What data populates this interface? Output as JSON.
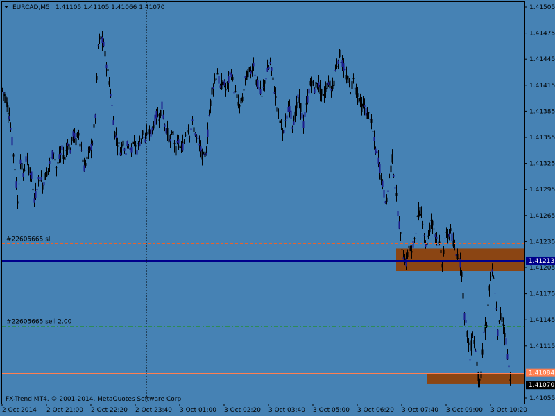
{
  "header": {
    "symbol_label": "EURCAD,M5",
    "ohlc": "1.41105 1.41105 1.41066 1.41070"
  },
  "footer": {
    "copyright": "FX-Trend MT4, © 2001-2014, MetaQuotes Software Corp."
  },
  "colors": {
    "background": "#4682b4",
    "frame": "#000000",
    "bar_body": "#1c1c8c",
    "bar_wick": "#000000",
    "zone": "#8b4513",
    "sl_line": "#e8632c",
    "order_line": "#2e8b57",
    "bid_line": "#00008b",
    "current_line": "#c0c0c0",
    "orange_line": "#ff7f50"
  },
  "chart_data": {
    "type": "candlestick",
    "symbol": "EURCAD",
    "timeframe": "M5",
    "ylim": [
      1.41055,
      1.41505
    ],
    "y_ticks": [
      "1.41505",
      "1.41475",
      "1.41445",
      "1.41415",
      "1.41385",
      "1.41355",
      "1.41325",
      "1.41295",
      "1.41265",
      "1.41235",
      "1.41205",
      "1.41175",
      "1.41145",
      "1.41115",
      "1.41085",
      "1.41055"
    ],
    "x_labels": [
      "2 Oct 2014",
      "2 Oct 21:00",
      "2 Oct 22:20",
      "2 Oct 23:40",
      "3 Oct 01:00",
      "3 Oct 02:20",
      "3 Oct 03:40",
      "3 Oct 05:00",
      "3 Oct 06:20",
      "3 Oct 07:40",
      "3 Oct 09:00",
      "3 Oct 10:20"
    ],
    "price_path": [
      [
        0,
        1.4141
      ],
      [
        5,
        1.414
      ],
      [
        10,
        1.4138
      ],
      [
        14,
        1.4135
      ],
      [
        18,
        1.4132
      ],
      [
        22,
        1.4128
      ],
      [
        26,
        1.4133
      ],
      [
        30,
        1.4131
      ],
      [
        34,
        1.4133
      ],
      [
        38,
        1.4132
      ],
      [
        42,
        1.4131
      ],
      [
        46,
        1.4128
      ],
      [
        50,
        1.413
      ],
      [
        54,
        1.4131
      ],
      [
        58,
        1.413
      ],
      [
        62,
        1.4131
      ],
      [
        66,
        1.4132
      ],
      [
        70,
        1.4133
      ],
      [
        74,
        1.4134
      ],
      [
        78,
        1.4132
      ],
      [
        82,
        1.4133
      ],
      [
        86,
        1.4134
      ],
      [
        90,
        1.4133
      ],
      [
        94,
        1.4135
      ],
      [
        98,
        1.4134
      ],
      [
        102,
        1.4136
      ],
      [
        106,
        1.4135
      ],
      [
        110,
        1.4136
      ],
      [
        114,
        1.4134
      ],
      [
        118,
        1.4132
      ],
      [
        122,
        1.4133
      ],
      [
        126,
        1.4134
      ],
      [
        130,
        1.4135
      ],
      [
        134,
        1.4138
      ],
      [
        138,
        1.4146
      ],
      [
        142,
        1.4147
      ],
      [
        146,
        1.4146
      ],
      [
        150,
        1.4144
      ],
      [
        154,
        1.4142
      ],
      [
        158,
        1.4139
      ],
      [
        162,
        1.4136
      ],
      [
        166,
        1.4135
      ],
      [
        170,
        1.4134
      ],
      [
        174,
        1.4135
      ],
      [
        178,
        1.4134
      ],
      [
        182,
        1.4135
      ],
      [
        186,
        1.4134
      ],
      [
        190,
        1.4135
      ],
      [
        194,
        1.4134
      ],
      [
        198,
        1.4135
      ],
      [
        202,
        1.4136
      ],
      [
        206,
        1.4135
      ],
      [
        210,
        1.4136
      ],
      [
        214,
        1.4136
      ],
      [
        218,
        1.4137
      ],
      [
        222,
        1.4138
      ],
      [
        226,
        1.4138
      ],
      [
        230,
        1.4139
      ],
      [
        234,
        1.4137
      ],
      [
        238,
        1.4136
      ],
      [
        242,
        1.4135
      ],
      [
        246,
        1.4136
      ],
      [
        250,
        1.4134
      ],
      [
        254,
        1.4135
      ],
      [
        258,
        1.4134
      ],
      [
        262,
        1.4135
      ],
      [
        266,
        1.4137
      ],
      [
        270,
        1.4136
      ],
      [
        274,
        1.4137
      ],
      [
        278,
        1.4136
      ],
      [
        282,
        1.4135
      ],
      [
        286,
        1.4134
      ],
      [
        290,
        1.4133
      ],
      [
        294,
        1.4134
      ],
      [
        298,
        1.4138
      ],
      [
        302,
        1.4141
      ],
      [
        306,
        1.4142
      ],
      [
        310,
        1.4143
      ],
      [
        314,
        1.4141
      ],
      [
        318,
        1.4142
      ],
      [
        322,
        1.4141
      ],
      [
        326,
        1.4142
      ],
      [
        330,
        1.4143
      ],
      [
        334,
        1.4141
      ],
      [
        338,
        1.414
      ],
      [
        342,
        1.4139
      ],
      [
        346,
        1.414
      ],
      [
        350,
        1.4142
      ],
      [
        354,
        1.4143
      ],
      [
        358,
        1.4143
      ],
      [
        362,
        1.4144
      ],
      [
        366,
        1.4142
      ],
      [
        370,
        1.4141
      ],
      [
        374,
        1.414
      ],
      [
        378,
        1.4142
      ],
      [
        382,
        1.4143
      ],
      [
        386,
        1.4144
      ],
      [
        390,
        1.4142
      ],
      [
        394,
        1.414
      ],
      [
        398,
        1.4138
      ],
      [
        402,
        1.4137
      ],
      [
        406,
        1.4136
      ],
      [
        410,
        1.4138
      ],
      [
        414,
        1.4139
      ],
      [
        418,
        1.4137
      ],
      [
        422,
        1.4138
      ],
      [
        426,
        1.414
      ],
      [
        430,
        1.4139
      ],
      [
        434,
        1.4137
      ],
      [
        438,
        1.4139
      ],
      [
        442,
        1.4141
      ],
      [
        446,
        1.4142
      ],
      [
        450,
        1.4141
      ],
      [
        454,
        1.4142
      ],
      [
        458,
        1.4141
      ],
      [
        462,
        1.414
      ],
      [
        466,
        1.4141
      ],
      [
        470,
        1.4142
      ],
      [
        474,
        1.4141
      ],
      [
        478,
        1.4142
      ],
      [
        482,
        1.4144
      ],
      [
        486,
        1.4145
      ],
      [
        490,
        1.4144
      ],
      [
        494,
        1.4143
      ],
      [
        498,
        1.4142
      ],
      [
        502,
        1.4141
      ],
      [
        506,
        1.4142
      ],
      [
        510,
        1.4141
      ],
      [
        514,
        1.414
      ],
      [
        518,
        1.4139
      ],
      [
        522,
        1.4139
      ],
      [
        526,
        1.4138
      ],
      [
        530,
        1.4138
      ],
      [
        534,
        1.4136
      ],
      [
        538,
        1.4134
      ],
      [
        542,
        1.4133
      ],
      [
        546,
        1.4131
      ],
      [
        550,
        1.4129
      ],
      [
        554,
        1.4128
      ],
      [
        558,
        1.4131
      ],
      [
        562,
        1.4133
      ],
      [
        566,
        1.413
      ],
      [
        570,
        1.4127
      ],
      [
        574,
        1.4124
      ],
      [
        578,
        1.4122
      ],
      [
        582,
        1.4121
      ],
      [
        586,
        1.4123
      ],
      [
        590,
        1.4122
      ],
      [
        594,
        1.4124
      ],
      [
        598,
        1.4126
      ],
      [
        602,
        1.4127
      ],
      [
        606,
        1.4126
      ],
      [
        610,
        1.4123
      ],
      [
        614,
        1.4124
      ],
      [
        618,
        1.4126
      ],
      [
        622,
        1.4125
      ],
      [
        626,
        1.4124
      ],
      [
        630,
        1.4123
      ],
      [
        634,
        1.4121
      ],
      [
        638,
        1.4124
      ],
      [
        642,
        1.4124
      ],
      [
        646,
        1.4125
      ],
      [
        650,
        1.4123
      ],
      [
        654,
        1.4122
      ],
      [
        658,
        1.4122
      ],
      [
        662,
        1.412
      ],
      [
        666,
        1.4115
      ],
      [
        670,
        1.4113
      ],
      [
        674,
        1.411
      ],
      [
        678,
        1.4113
      ],
      [
        682,
        1.4111
      ],
      [
        686,
        1.4108
      ],
      [
        690,
        1.4108
      ],
      [
        694,
        1.4113
      ],
      [
        698,
        1.4114
      ],
      [
        702,
        1.4118
      ],
      [
        706,
        1.412
      ],
      [
        710,
        1.4118
      ],
      [
        714,
        1.4113
      ],
      [
        718,
        1.4115
      ],
      [
        722,
        1.4114
      ],
      [
        726,
        1.4112
      ],
      [
        730,
        1.4109
      ],
      [
        734,
        1.4107
      ]
    ],
    "levels": [
      {
        "name": "#22605665 sl",
        "price": 1.41233,
        "style": "dashed",
        "color": "#e8632c"
      },
      {
        "name": "#22605665 sell 2.00",
        "price": 1.41138,
        "style": "dashdot",
        "color": "#2e8b57"
      },
      {
        "name": "bid",
        "price": 1.41213,
        "style": "solid",
        "color": "#00008b",
        "badge": "1.41213"
      },
      {
        "name": "level",
        "price": 1.41084,
        "style": "solid",
        "color": "#ff7f50",
        "badge": "1.41084"
      },
      {
        "name": "current",
        "price": 1.4107,
        "style": "solid",
        "color": "#c0c0c0",
        "badge": "1.41070"
      }
    ],
    "zones": [
      {
        "from_price": 1.41227,
        "to_price": 1.41201
      },
      {
        "from_price": 1.41083,
        "to_price": 1.41071
      }
    ]
  }
}
